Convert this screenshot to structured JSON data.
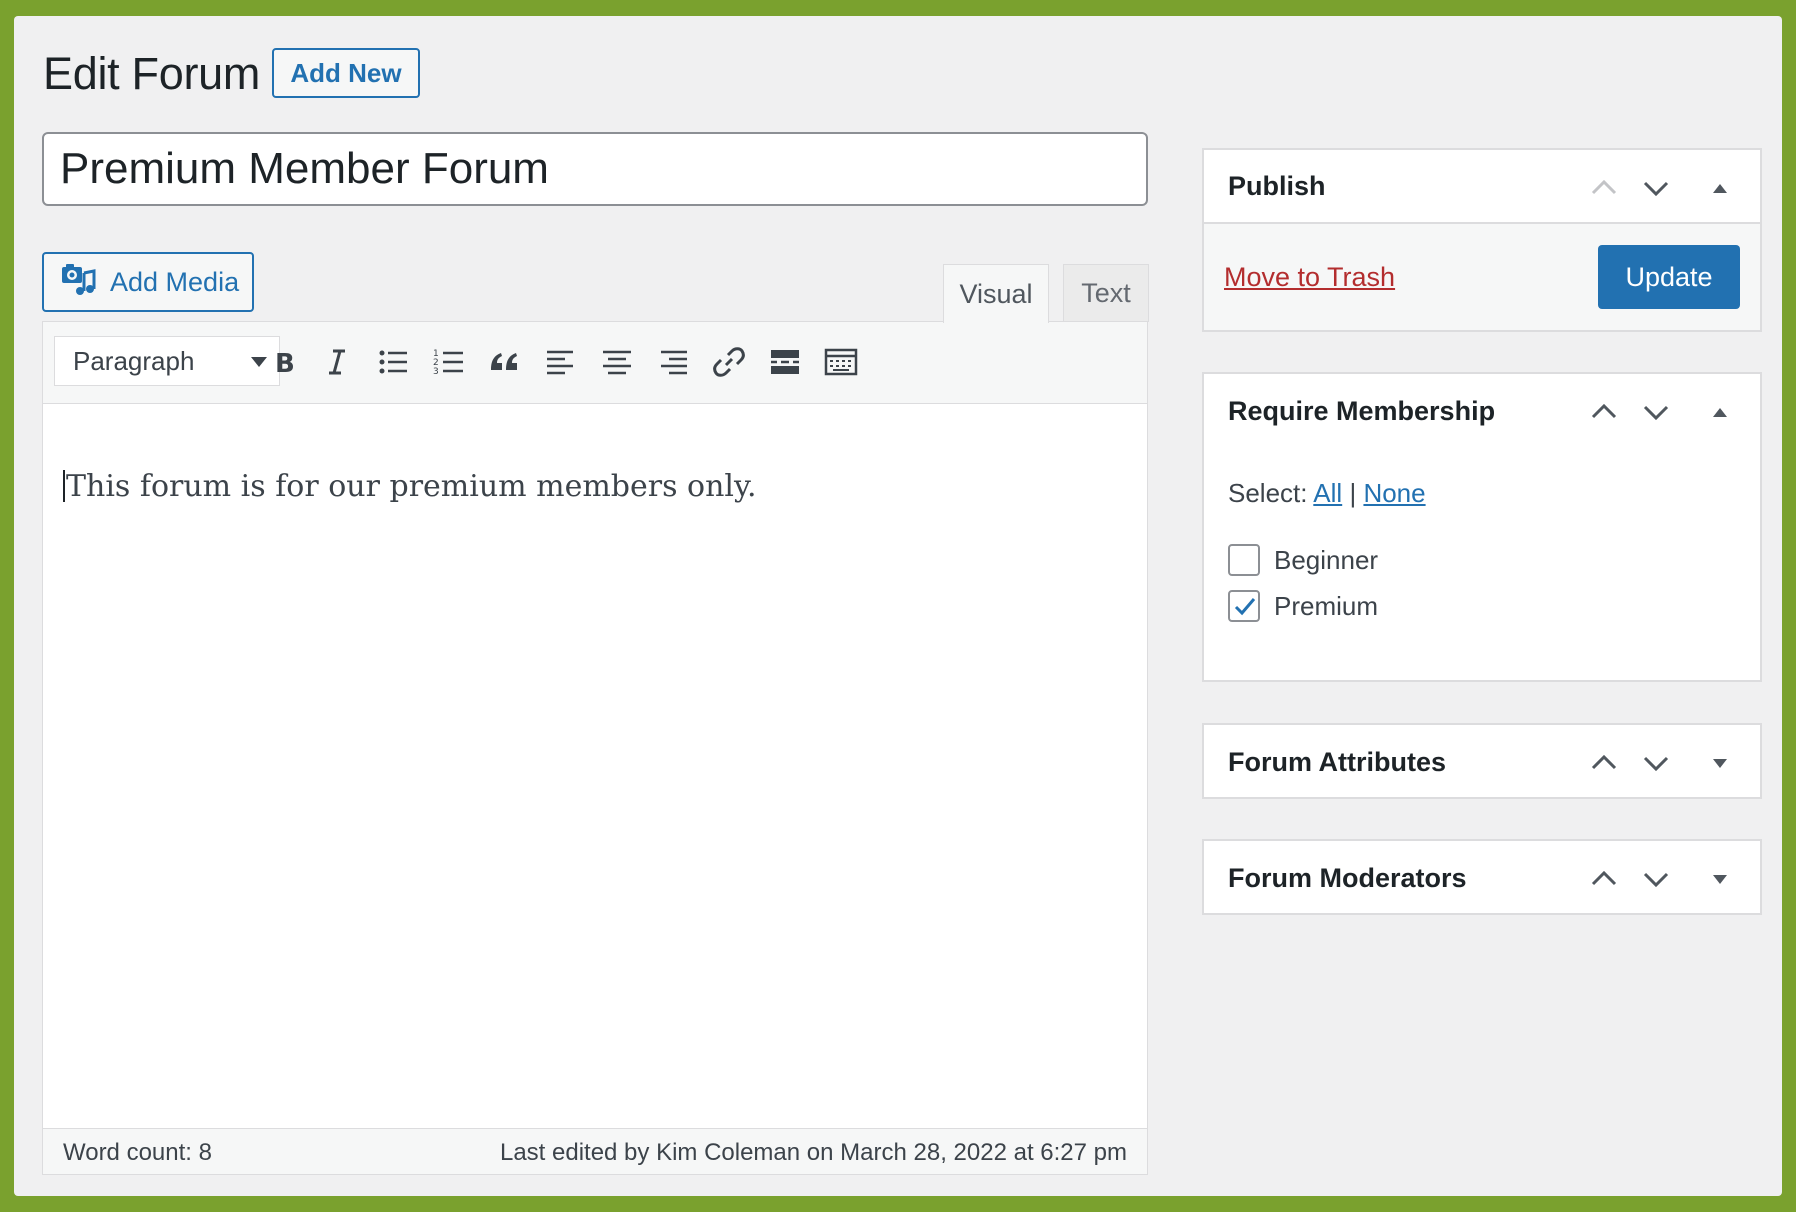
{
  "header": {
    "title": "Edit Forum",
    "add_new_label": "Add New"
  },
  "post": {
    "title_value": "Premium Member Forum",
    "content": "This forum is for our premium members only."
  },
  "editor": {
    "add_media_label": "Add Media",
    "tabs": [
      {
        "label": "Visual",
        "active": true
      },
      {
        "label": "Text",
        "active": false
      }
    ],
    "format_select": "Paragraph",
    "toolbar_icons": [
      "bold-icon",
      "italic-icon",
      "bulleted-list-icon",
      "numbered-list-icon",
      "blockquote-icon",
      "align-left-icon",
      "align-center-icon",
      "align-right-icon",
      "link-icon",
      "read-more-icon",
      "toolbar-toggle-icon"
    ],
    "word_count": "Word count: 8",
    "last_edited": "Last edited by Kim Coleman on March 28, 2022 at 6:27 pm"
  },
  "sidebar": {
    "publish": {
      "title": "Publish",
      "trash_label": "Move to Trash",
      "update_label": "Update"
    },
    "membership": {
      "title": "Require Membership",
      "select_prefix": "Select:",
      "select_all": "All",
      "separator": "|",
      "select_none": "None",
      "levels": [
        {
          "label": "Beginner",
          "checked": false
        },
        {
          "label": "Premium",
          "checked": true
        }
      ]
    },
    "attributes": {
      "title": "Forum Attributes"
    },
    "moderators": {
      "title": "Forum Moderators"
    }
  },
  "colors": {
    "accent": "#2271b1",
    "danger": "#b32d2e",
    "frame": "#7aa12e",
    "background": "#f0f0f1"
  }
}
